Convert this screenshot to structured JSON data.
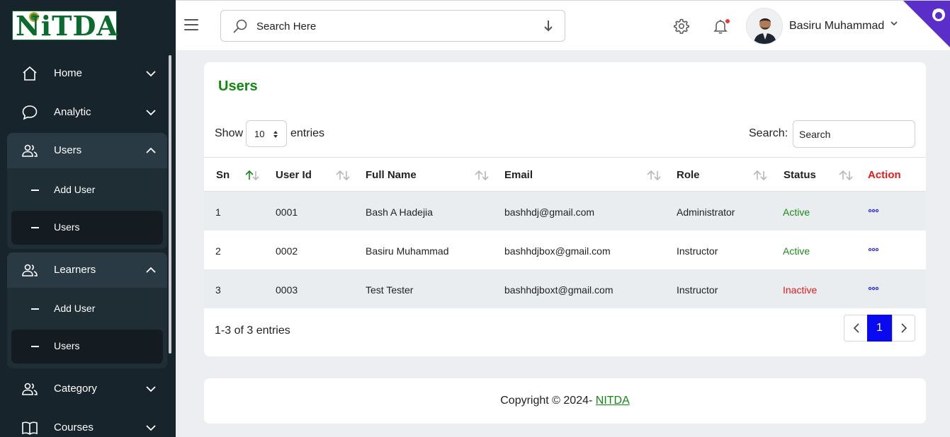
{
  "app": {
    "logo_text": "NiTDA",
    "brand_color": "#128a12",
    "sidebar_bg": "#18242b"
  },
  "sidebar": {
    "items": [
      {
        "label": "Home",
        "icon": "home-icon",
        "expanded": false
      },
      {
        "label": "Analytic",
        "icon": "chat-bubble-icon",
        "expanded": false
      },
      {
        "label": "Users",
        "icon": "users-icon",
        "expanded": true,
        "children": [
          {
            "label": "Add User",
            "active": false
          },
          {
            "label": "Users",
            "active": true
          }
        ]
      },
      {
        "label": "Learners",
        "icon": "users-icon",
        "expanded": true,
        "children": [
          {
            "label": "Add User",
            "active": false
          },
          {
            "label": "Users",
            "active": true
          }
        ]
      },
      {
        "label": "Category",
        "icon": "users-icon",
        "expanded": false
      },
      {
        "label": "Courses",
        "icon": "book-icon",
        "expanded": false
      }
    ]
  },
  "header": {
    "search_placeholder": "Search Here",
    "user_name": "Basiru Muhammad",
    "notification_dot_color": "#e53935"
  },
  "page": {
    "title": "Users",
    "show_label": "Show",
    "entries_value": "10",
    "entries_label": "entries",
    "search_label": "Search:",
    "search_placeholder": "Search",
    "columns": [
      "Sn",
      "User Id",
      "Full Name",
      "Email",
      "Role",
      "Status",
      "Action"
    ],
    "rows": [
      {
        "sn": "1",
        "user_id": "0001",
        "full_name": "Bash A Hadejia",
        "email": "bashhdj@gmail.com",
        "role": "Administrator",
        "status": "Active"
      },
      {
        "sn": "2",
        "user_id": "0002",
        "full_name": "Basiru Muhammad",
        "email": "bashhdjbox@gmail.com",
        "role": "Instructor",
        "status": "Active"
      },
      {
        "sn": "3",
        "user_id": "0003",
        "full_name": "Test Tester",
        "email": "bashhdjboxt@gmail.com",
        "role": "Instructor",
        "status": "Inactive"
      }
    ],
    "info": "1-3 of 3 entries",
    "current_page": "1",
    "status_colors": {
      "Active": "#1a8a1a",
      "Inactive": "#e01b1b"
    },
    "action_color": "#e01b1b"
  },
  "footer": {
    "text": "Copyright © 2024- ",
    "link": "NITDA"
  }
}
